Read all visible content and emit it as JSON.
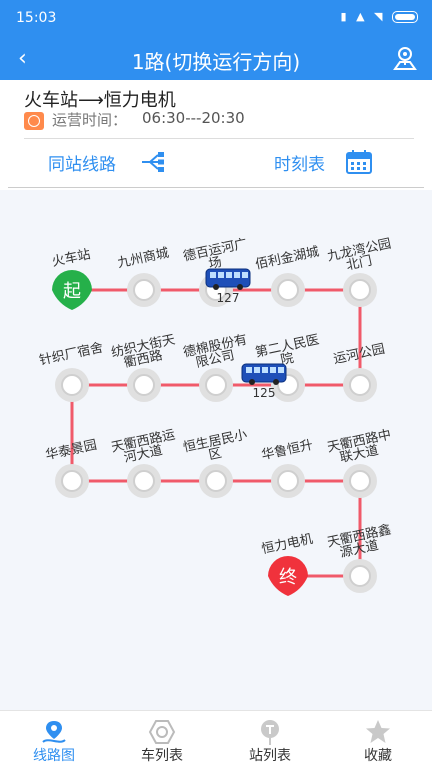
{
  "status_bar": {
    "time": "15:03"
  },
  "header": {
    "title": "1路(切换运行方向)",
    "back_icon": "back-arrow-icon",
    "map_icon": "route-map-pin-icon"
  },
  "route": {
    "name": "火车站⟶恒力电机",
    "op_time_label": "运营时间：",
    "op_time_value": "06:30---20:30"
  },
  "actions": {
    "same_station": "同站线路",
    "timetable": "时刻表"
  },
  "map": {
    "line_color": "#f05a6a",
    "start_marker": "起",
    "end_marker": "终",
    "stations": [
      "火车站",
      "九州商城",
      "德百运河广场",
      "佰利金湖城",
      "九龙湾公园北门",
      "运河公园",
      "第二人民医院",
      "德棉股份有限公司",
      "纺织大街天衢西路",
      "针织厂宿舍",
      "华泰景园",
      "天衢西路运河大道",
      "恒生居民小区",
      "华鲁恒升",
      "天衢西路中联大道",
      "天衢西路鑫源大道",
      "恒力电机"
    ],
    "buses": [
      {
        "number": "127"
      },
      {
        "number": "125"
      }
    ]
  },
  "tabs": [
    {
      "label": "线路图",
      "icon": "route-icon",
      "active": true
    },
    {
      "label": "车列表",
      "icon": "bus-list-icon",
      "active": false
    },
    {
      "label": "站列表",
      "icon": "station-list-icon",
      "active": false
    },
    {
      "label": "收藏",
      "icon": "star-icon",
      "active": false
    }
  ]
}
